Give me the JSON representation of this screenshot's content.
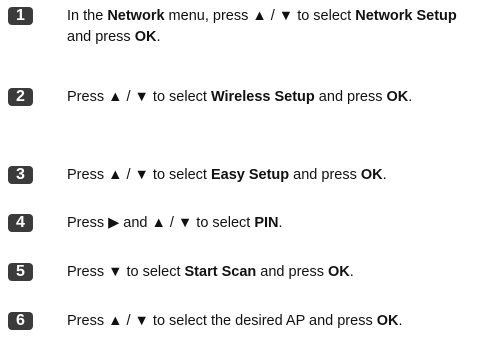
{
  "steps": [
    {
      "number": "1",
      "segments": [
        {
          "text": "In the ",
          "bold": false
        },
        {
          "text": "Network",
          "bold": true
        },
        {
          "text": " menu, press ▲ / ▼ to select ",
          "bold": false
        },
        {
          "text": "Network Setup",
          "bold": true
        },
        {
          "text": " and press ",
          "bold": false
        },
        {
          "text": "OK",
          "bold": true
        },
        {
          "text": ".",
          "bold": false
        }
      ]
    },
    {
      "number": "2",
      "segments": [
        {
          "text": "Press ▲ / ▼ to select ",
          "bold": false
        },
        {
          "text": "Wireless Setup",
          "bold": true
        },
        {
          "text": " and press ",
          "bold": false
        },
        {
          "text": "OK",
          "bold": true
        },
        {
          "text": ".",
          "bold": false
        }
      ]
    },
    {
      "number": "3",
      "segments": [
        {
          "text": "Press ▲ / ▼ to select ",
          "bold": false
        },
        {
          "text": "Easy Setup",
          "bold": true
        },
        {
          "text": " and press ",
          "bold": false
        },
        {
          "text": "OK",
          "bold": true
        },
        {
          "text": ".",
          "bold": false
        }
      ]
    },
    {
      "number": "4",
      "segments": [
        {
          "text": "Press ▶ and ▲ / ▼ to select ",
          "bold": false
        },
        {
          "text": "PIN",
          "bold": true
        },
        {
          "text": ".",
          "bold": false
        }
      ]
    },
    {
      "number": "5",
      "segments": [
        {
          "text": "Press ▼ to select ",
          "bold": false
        },
        {
          "text": "Start Scan",
          "bold": true
        },
        {
          "text": " and press ",
          "bold": false
        },
        {
          "text": "OK",
          "bold": true
        },
        {
          "text": ".",
          "bold": false
        }
      ]
    },
    {
      "number": "6",
      "segments": [
        {
          "text": "Press ▲ / ▼ to select the desired AP and press ",
          "bold": false
        },
        {
          "text": "OK",
          "bold": true
        },
        {
          "text": ".",
          "bold": false
        }
      ]
    }
  ]
}
